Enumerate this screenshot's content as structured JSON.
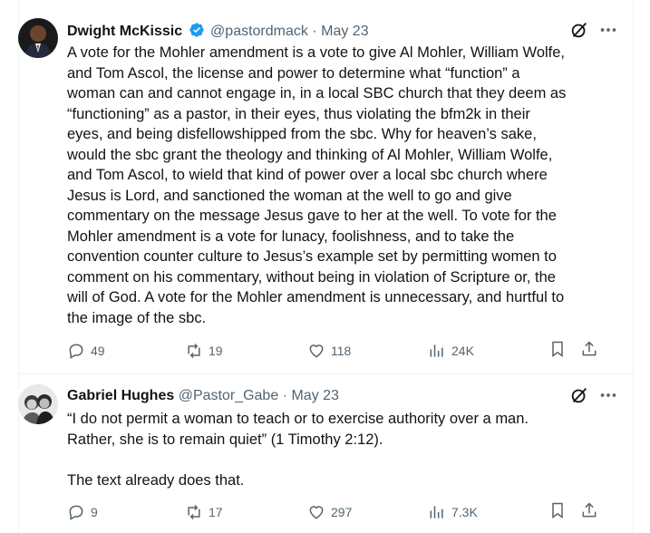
{
  "tweets": [
    {
      "name": "Dwight McKissic",
      "handle": "@pastordmack",
      "separator": "·",
      "date": "May 23",
      "text": "A vote for the Mohler amendment is a vote to give Al Mohler, William Wolfe,\nand Tom Ascol, the license and power to determine what “function” a\nwoman can and cannot engage in, in a local SBC church that they deem as\n“functioning” as a pastor, in their eyes, thus violating the bfm2k in their\neyes, and being disfellowshipped from the sbc. Why for heaven’s sake,\nwould the sbc grant the theology and thinking of Al Mohler, William Wolfe,\nand Tom Ascol, to wield that kind of power over a local sbc church where\nJesus is Lord, and sanctioned the woman at the well to go and give\ncommentary on the message Jesus gave to her at the well. To vote for the\nMohler amendment is a vote for lunacy, foolishness, and to take the\nconvention counter culture to Jesus’s example set by permitting women to\ncomment on his commentary, without being in violation of Scripture or, the\nwill of God. A vote for the Mohler amendment is unnecessary, and hurtful to\nthe image of the sbc.",
      "replies": "49",
      "reposts": "19",
      "likes": "118",
      "views": "24K"
    },
    {
      "name": "Gabriel Hughes",
      "handle": "@Pastor_Gabe",
      "separator": "·",
      "date": "May 23",
      "text": "“I do not permit a woman to teach or to exercise authority over a man.\nRather, she is to remain quiet” (1 Timothy 2:12).\n\nThe text already does that.",
      "replies": "9",
      "reposts": "17",
      "likes": "297",
      "views": "7.3K"
    }
  ],
  "colors": {
    "text": "#0f1419",
    "muted": "#536471",
    "verified": "#1d9bf0",
    "border": "#eff3f4"
  },
  "icons": [
    "verified-badge-icon",
    "grok-icon",
    "more-icon",
    "reply-icon",
    "repost-icon",
    "like-icon",
    "views-icon",
    "bookmark-icon",
    "share-icon"
  ]
}
